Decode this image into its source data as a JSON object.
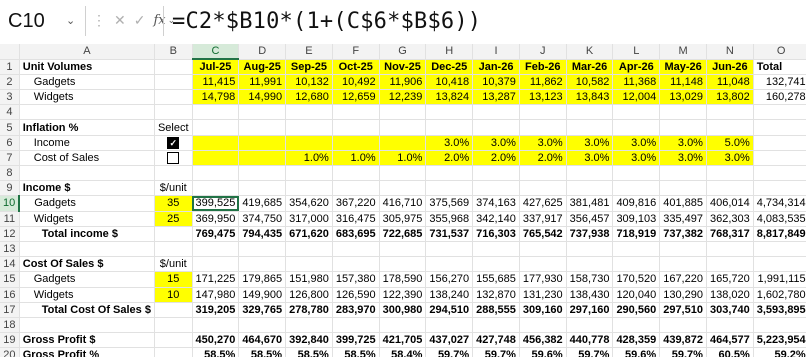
{
  "namebox": {
    "cell": "C10"
  },
  "formula": "=C2*$B10*(1+(C$6*$B$6))",
  "columns": [
    "A",
    "B",
    "C",
    "D",
    "E",
    "F",
    "G",
    "H",
    "I",
    "J",
    "K",
    "L",
    "M",
    "N",
    "O"
  ],
  "rows": [
    {
      "n": "1",
      "a": "Unit Volumes",
      "b": "",
      "months": [
        "Jul-25",
        "Aug-25",
        "Sep-25",
        "Oct-25",
        "Nov-25",
        "Dec-25",
        "Jan-26",
        "Feb-26",
        "Mar-26",
        "Apr-26",
        "May-26",
        "Jun-26"
      ],
      "o": "Total"
    },
    {
      "n": "2",
      "a": "Gadgets",
      "b": "",
      "months": [
        "11,415",
        "11,991",
        "10,132",
        "10,492",
        "11,906",
        "10,418",
        "10,379",
        "11,862",
        "10,582",
        "11,368",
        "11,148",
        "11,048"
      ],
      "o": "132,741"
    },
    {
      "n": "3",
      "a": "Widgets",
      "b": "",
      "months": [
        "14,798",
        "14,990",
        "12,680",
        "12,659",
        "12,239",
        "13,824",
        "13,287",
        "13,123",
        "13,843",
        "12,004",
        "13,029",
        "13,802"
      ],
      "o": "160,278"
    },
    {
      "n": "4",
      "a": "",
      "b": "",
      "months": [
        "",
        "",
        "",
        "",
        "",
        "",
        "",
        "",
        "",
        "",
        "",
        ""
      ],
      "o": ""
    },
    {
      "n": "5",
      "a": "Inflation %",
      "b": "Select",
      "months": [
        "",
        "",
        "",
        "",
        "",
        "",
        "",
        "",
        "",
        "",
        "",
        ""
      ],
      "o": ""
    },
    {
      "n": "6",
      "a": "Income",
      "b": "checked",
      "months": [
        "",
        "",
        "",
        "",
        "",
        "3.0%",
        "3.0%",
        "3.0%",
        "3.0%",
        "3.0%",
        "3.0%",
        "5.0%"
      ],
      "o": ""
    },
    {
      "n": "7",
      "a": "Cost of Sales",
      "b": "unchecked",
      "months": [
        "",
        "",
        "1.0%",
        "1.0%",
        "1.0%",
        "2.0%",
        "2.0%",
        "2.0%",
        "3.0%",
        "3.0%",
        "3.0%",
        "3.0%"
      ],
      "o": ""
    },
    {
      "n": "8",
      "a": "",
      "b": "",
      "months": [
        "",
        "",
        "",
        "",
        "",
        "",
        "",
        "",
        "",
        "",
        "",
        ""
      ],
      "o": ""
    },
    {
      "n": "9",
      "a": "Income $",
      "b": "$/unit",
      "months": [
        "",
        "",
        "",
        "",
        "",
        "",
        "",
        "",
        "",
        "",
        "",
        ""
      ],
      "o": ""
    },
    {
      "n": "10",
      "a": "Gadgets",
      "b": "35",
      "months": [
        "399,525",
        "419,685",
        "354,620",
        "367,220",
        "416,710",
        "375,569",
        "374,163",
        "427,625",
        "381,481",
        "409,816",
        "401,885",
        "406,014"
      ],
      "o": "4,734,314"
    },
    {
      "n": "11",
      "a": "Widgets",
      "b": "25",
      "months": [
        "369,950",
        "374,750",
        "317,000",
        "316,475",
        "305,975",
        "355,968",
        "342,140",
        "337,917",
        "356,457",
        "309,103",
        "335,497",
        "362,303"
      ],
      "o": "4,083,535"
    },
    {
      "n": "12",
      "a": "Total income $",
      "b": "",
      "months": [
        "769,475",
        "794,435",
        "671,620",
        "683,695",
        "722,685",
        "731,537",
        "716,303",
        "765,542",
        "737,938",
        "718,919",
        "737,382",
        "768,317"
      ],
      "o": "8,817,849"
    },
    {
      "n": "13",
      "a": "",
      "b": "",
      "months": [
        "",
        "",
        "",
        "",
        "",
        "",
        "",
        "",
        "",
        "",
        "",
        ""
      ],
      "o": ""
    },
    {
      "n": "14",
      "a": "Cost Of Sales $",
      "b": "$/unit",
      "months": [
        "",
        "",
        "",
        "",
        "",
        "",
        "",
        "",
        "",
        "",
        "",
        ""
      ],
      "o": ""
    },
    {
      "n": "15",
      "a": "Gadgets",
      "b": "15",
      "months": [
        "171,225",
        "179,865",
        "151,980",
        "157,380",
        "178,590",
        "156,270",
        "155,685",
        "177,930",
        "158,730",
        "170,520",
        "167,220",
        "165,720"
      ],
      "o": "1,991,115"
    },
    {
      "n": "16",
      "a": "Widgets",
      "b": "10",
      "months": [
        "147,980",
        "149,900",
        "126,800",
        "126,590",
        "122,390",
        "138,240",
        "132,870",
        "131,230",
        "138,430",
        "120,040",
        "130,290",
        "138,020"
      ],
      "o": "1,602,780"
    },
    {
      "n": "17",
      "a": "Total Cost Of Sales $",
      "b": "",
      "months": [
        "319,205",
        "329,765",
        "278,780",
        "283,970",
        "300,980",
        "294,510",
        "288,555",
        "309,160",
        "297,160",
        "290,560",
        "297,510",
        "303,740"
      ],
      "o": "3,593,895"
    },
    {
      "n": "18",
      "a": "",
      "b": "",
      "months": [
        "",
        "",
        "",
        "",
        "",
        "",
        "",
        "",
        "",
        "",
        "",
        ""
      ],
      "o": ""
    },
    {
      "n": "19",
      "a": "Gross Profit $",
      "b": "",
      "months": [
        "450,270",
        "464,670",
        "392,840",
        "399,725",
        "421,705",
        "437,027",
        "427,748",
        "456,382",
        "440,778",
        "428,359",
        "439,872",
        "464,577"
      ],
      "o": "5,223,954"
    },
    {
      "n": "20",
      "a": "Gross Profit %",
      "b": "",
      "months": [
        "58.5%",
        "58.5%",
        "58.5%",
        "58.5%",
        "58.4%",
        "59.7%",
        "59.7%",
        "59.6%",
        "59.7%",
        "59.6%",
        "59.7%",
        "60.5%"
      ],
      "o": "59.2%"
    }
  ],
  "styles": {
    "highlight_color": "#ffff00",
    "selection_color": "#217346"
  }
}
